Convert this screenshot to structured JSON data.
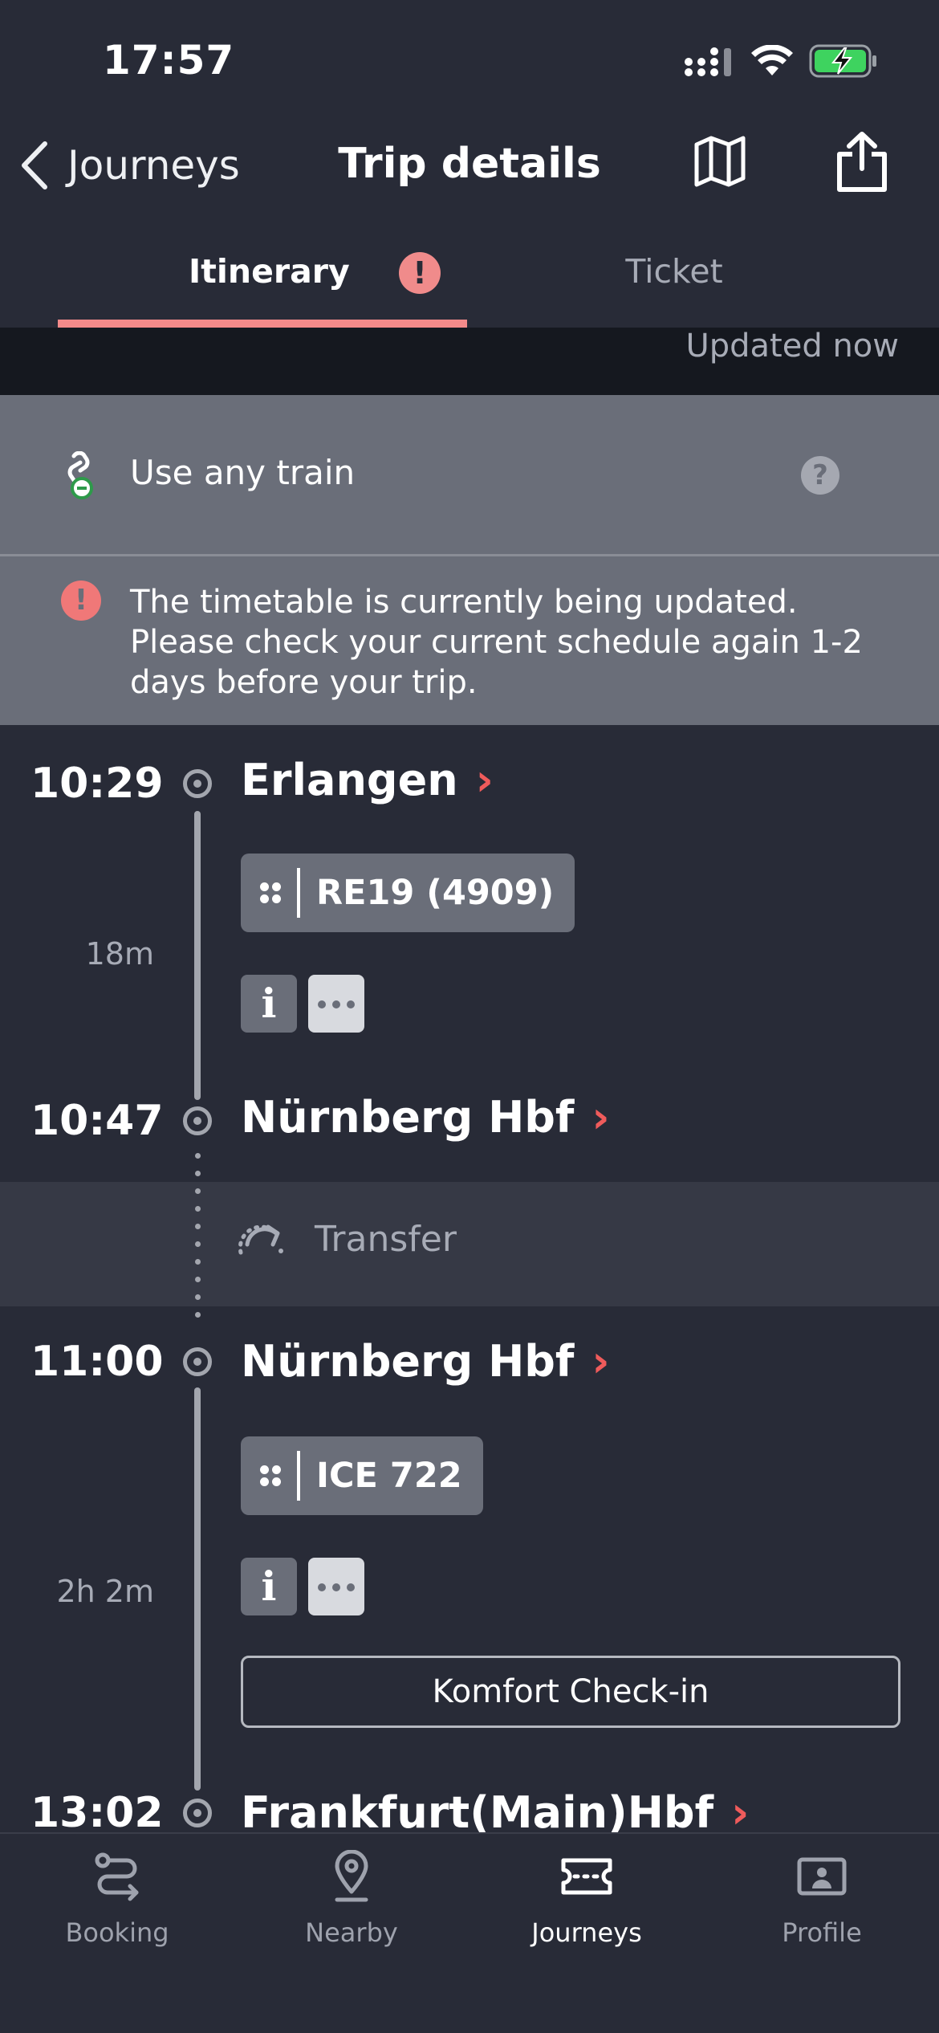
{
  "status_bar": {
    "time": "17:57"
  },
  "nav": {
    "back_label": "Journeys",
    "title": "Trip details"
  },
  "tabs": [
    {
      "label": "Itinerary",
      "alert": "!",
      "active": true
    },
    {
      "label": "Ticket",
      "active": false
    }
  ],
  "updated": "Updated now",
  "notices": {
    "any_train": "Use any train",
    "help": "?",
    "timetable_alert": "!",
    "timetable": "The timetable is currently being updated. Please check your current schedule again 1-2 days before your trip."
  },
  "legs": [
    {
      "dep_time": "10:29",
      "dep_station": "Erlangen",
      "train": "RE19 (4909)",
      "duration": "18m",
      "arr_time": "10:47",
      "arr_station": "Nürnberg Hbf"
    },
    {
      "dep_time": "11:00",
      "dep_station": "Nürnberg Hbf",
      "train": "ICE 722",
      "duration": "2h 2m",
      "checkin": "Komfort Check-in",
      "arr_time": "13:02",
      "arr_station": "Frankfurt(Main)Hbf"
    }
  ],
  "transfer": "Transfer",
  "info_label": "i",
  "chevron": "›",
  "bottom_tabs": [
    {
      "label": "Booking",
      "icon": "route-icon"
    },
    {
      "label": "Nearby",
      "icon": "location-pin-icon"
    },
    {
      "label": "Journeys",
      "icon": "ticket-icon",
      "active": true
    },
    {
      "label": "Profile",
      "icon": "profile-card-icon"
    }
  ],
  "colors": {
    "background": "#282b37",
    "accent": "#f48a8a",
    "chevron": "#ef5b5b",
    "notice": "#6a6e79"
  }
}
